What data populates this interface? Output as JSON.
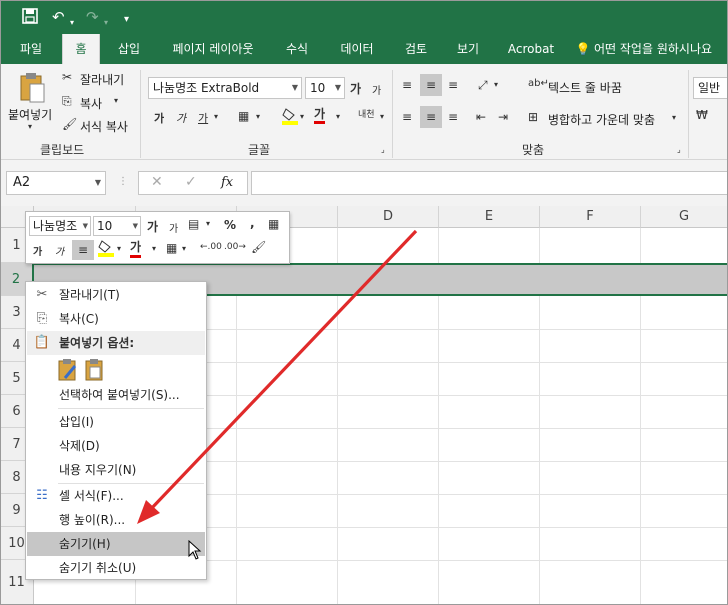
{
  "quick_access": {
    "save_icon": "save-icon",
    "undo_icon": "undo-icon",
    "redo_icon": "redo-icon",
    "customize_icon": "customize-icon"
  },
  "tabs": [
    {
      "label": "파일"
    },
    {
      "label": "홈"
    },
    {
      "label": "삽입"
    },
    {
      "label": "페이지 레이아웃"
    },
    {
      "label": "수식"
    },
    {
      "label": "데이터"
    },
    {
      "label": "검토"
    },
    {
      "label": "보기"
    },
    {
      "label": "Acrobat"
    }
  ],
  "tell_me": "어떤 작업을 원하시나요",
  "clipboard": {
    "paste": "붙여넣기",
    "cut": "잘라내기",
    "copy": "복사",
    "format_painter": "서식 복사",
    "group_label": "클립보드"
  },
  "font": {
    "name": "나눔명조 ExtraBold",
    "size": "10",
    "grow": "가",
    "shrink": "가",
    "bold": "가",
    "italic": "가",
    "underline": "가",
    "font_color": "가",
    "phonetic": "내천",
    "group_label": "글꼴"
  },
  "alignment": {
    "wrap_text": "텍스트 줄 바꿈",
    "merge_center": "병합하고 가운데 맞춤",
    "group_label": "맞춤"
  },
  "number": {
    "format": "일반"
  },
  "formula_bar": {
    "name_box": "A2",
    "fx": "fx"
  },
  "columns": [
    "D",
    "E",
    "F",
    "G"
  ],
  "rows": [
    "1",
    "2",
    "3",
    "4",
    "5",
    "6",
    "7",
    "8",
    "9",
    "10",
    "11"
  ],
  "mini_toolbar": {
    "font": "나눔명조",
    "size": "10",
    "grow": "가",
    "shrink": "가",
    "percent": "%",
    "comma": ",",
    "bold": "가",
    "italic": "가",
    "font_color": "가",
    "dec_increase": ".00",
    "dec_decrease": ".00"
  },
  "context_menu": {
    "cut": "잘라내기(T)",
    "copy": "복사(C)",
    "paste_options": "붙여넣기 옵션:",
    "paste_special": "선택하여 붙여넣기(S)...",
    "insert": "삽입(I)",
    "delete": "삭제(D)",
    "clear_contents": "내용 지우기(N)",
    "format_cells": "셀 서식(F)...",
    "row_height": "행 높이(R)...",
    "hide": "숨기기(H)",
    "unhide": "숨기기 취소(U)"
  },
  "colors": {
    "excel_green": "#217346",
    "annotation_arrow": "#e02a2a",
    "selection_border": "#217346",
    "selected_row": "#c8c8c8"
  }
}
